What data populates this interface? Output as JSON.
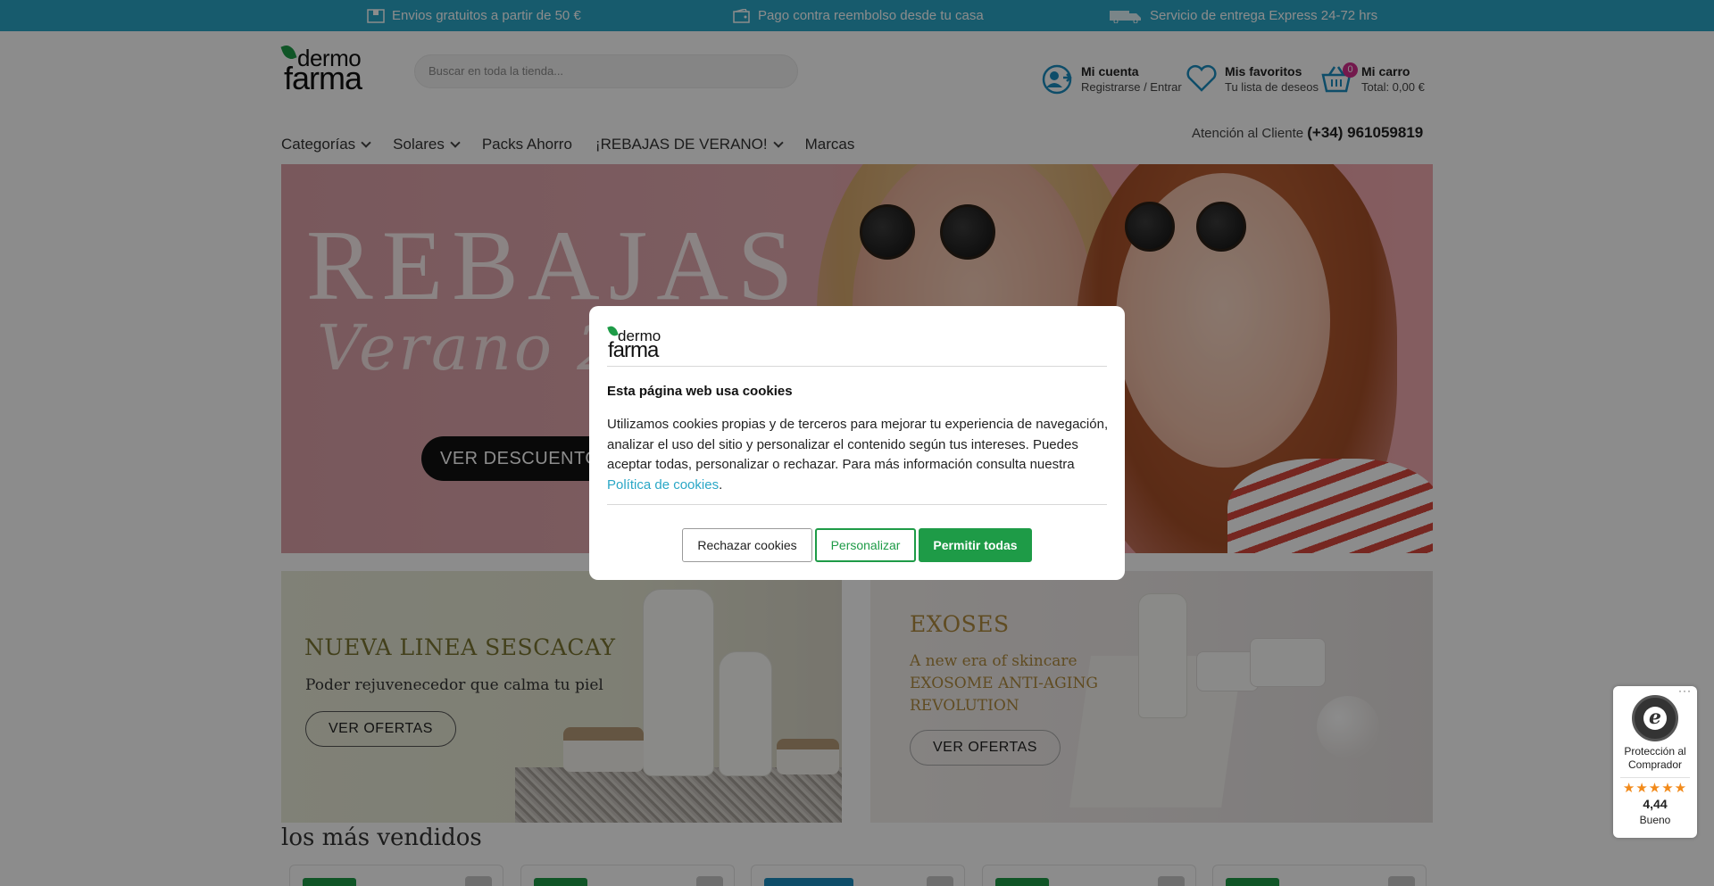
{
  "topbar": {
    "promo1": "Envios gratuitos a partir de 50 €",
    "promo2": "Pago contra reembolso desde tu casa",
    "promo3": "Servicio de entrega Express 24-72 hrs"
  },
  "logo": {
    "line1": "dermo",
    "line2": "farma"
  },
  "search": {
    "placeholder": "Buscar en toda la tienda..."
  },
  "header": {
    "account_title": "Mi cuenta",
    "account_sub": "Registrarse / Entrar",
    "favorites_title": "Mis favoritos",
    "favorites_sub": "Tu lista de deseos",
    "cart_title": "Mi carro",
    "cart_total": "Total: 0,00 €",
    "cart_count": "0"
  },
  "nav": {
    "categories": "Categorías",
    "solares": "Solares",
    "packs": "Packs Ahorro",
    "rebajas": "¡REBAJAS DE VERANO!",
    "marcas": "Marcas"
  },
  "support": {
    "label": "Atención al Cliente",
    "phone": "(+34) 961059819"
  },
  "hero": {
    "title": "REBAJAS",
    "subtitle": "Verano 2",
    "button": "VER DESCUENTOS"
  },
  "cards": [
    {
      "title": "NUEVA LINEA SESCACAY",
      "subtitle": "Poder rejuvenecedor que calma tu piel",
      "button": "VER OFERTAS",
      "title_color": "#7a7632"
    },
    {
      "title": "EXOSES",
      "subtitle_1": "A new era of skincare",
      "subtitle_2": "EXOSOME ANTI-AGING",
      "subtitle_3": "REVOLUTION",
      "button": "VER OFERTAS",
      "title_color": "#b08a3e"
    }
  ],
  "bestsellers": {
    "title": "los más vendidos"
  },
  "cookie": {
    "logo_line1": "dermo",
    "logo_line2": "farma",
    "title": "Esta página web usa cookies",
    "text": "Utilizamos cookies propias y de terceros para mejorar tu experiencia de navegación, analizar el uso del sitio y personalizar el contenido según tus intereses. Puedes aceptar todas, personalizar o rechazar. Para más información consulta nuestra ",
    "link": "Política de cookies",
    "link_suffix": ".",
    "reject": "Rechazar cookies",
    "customize": "Personalizar",
    "accept": "Permitir todas"
  },
  "trusted": {
    "seal_letter": "e",
    "label": "Protección al Comprador",
    "stars": "★★★★★",
    "score": "4,44",
    "grade": "Bueno",
    "menu": "···"
  },
  "colors": {
    "topbar": "#2aa7c6",
    "brand_green": "#1e9b47",
    "link": "#2aa7c6",
    "badge": "#d22e8c"
  }
}
